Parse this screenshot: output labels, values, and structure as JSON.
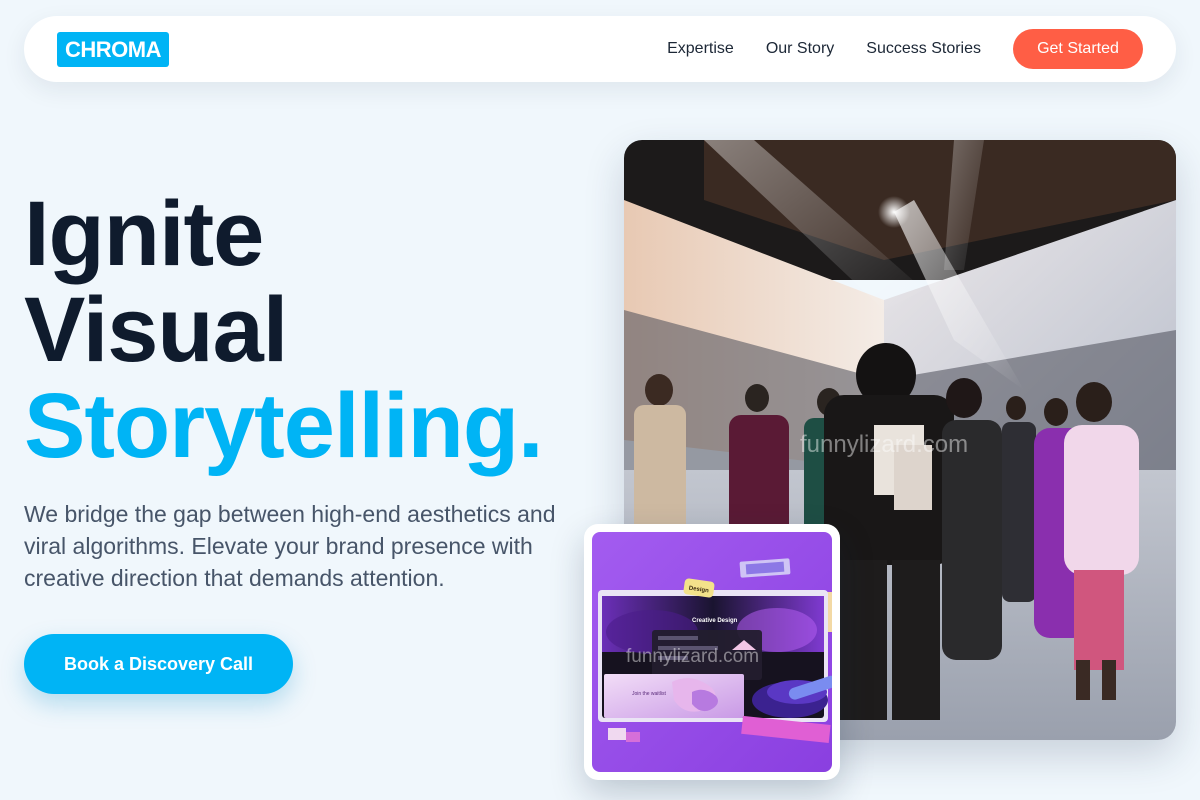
{
  "header": {
    "logo": "CHROMA",
    "nav": [
      "Expertise",
      "Our Story",
      "Success Stories"
    ],
    "cta": "Get Started"
  },
  "hero": {
    "title_line1": "Ignite",
    "title_line2": "Visual",
    "title_line3": "Storytelling.",
    "description": "We bridge the gap between high-end aesthetics and viral algorithms. Elevate your brand presence with creative direction that demands attention.",
    "button": "Book a Discovery Call"
  },
  "images": {
    "main_watermark": "funnylizard.com",
    "card_watermark": "funnylizard.com",
    "card_sticker": "Design",
    "card_app_title": "Creative Design",
    "card_caption": "Join the waitlist"
  },
  "colors": {
    "accent": "#00b4f5",
    "cta": "#ff5e45",
    "heading": "#0f1b2d",
    "body_text": "#475569",
    "background": "#f0f7fc"
  }
}
